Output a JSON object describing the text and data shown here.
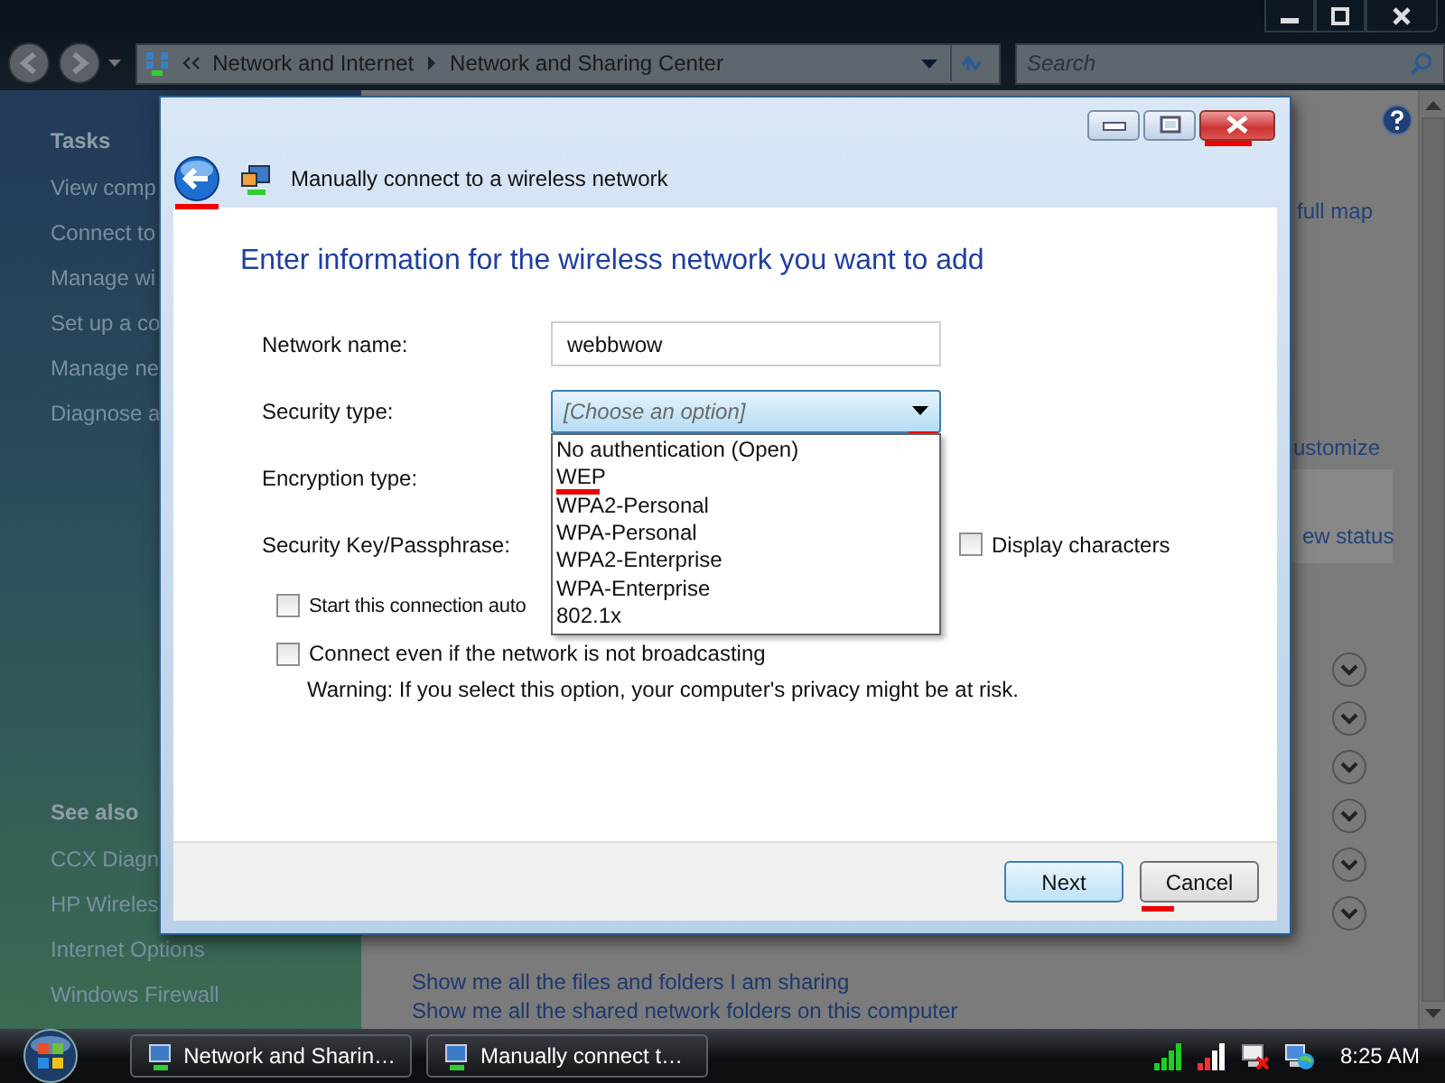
{
  "explorer": {
    "breadcrumb": [
      "Network and Internet",
      "Network and Sharing Center"
    ],
    "search": {
      "placeholder": "Search"
    },
    "tasks": {
      "heading": "Tasks",
      "items": [
        "View comp",
        "Connect to",
        "Manage wi",
        "Set up a co",
        "Manage ne",
        "Diagnose a"
      ]
    },
    "see_also": {
      "heading": "See also",
      "items": [
        "CCX Diagn",
        "HP Wireles",
        "Internet Options",
        "Windows Firewall"
      ]
    },
    "fragments": {
      "map_link": "full map",
      "customize_link": "ustomize",
      "status_link": "ew status"
    },
    "expand_buttons": [
      {
        "expanded": false
      },
      {
        "expanded": false
      },
      {
        "expanded": false
      },
      {
        "expanded": false
      },
      {
        "expanded": false
      },
      {
        "expanded": false
      }
    ],
    "links": [
      "Show me all the files and folders I am sharing",
      "Show me all the shared network folders on this computer"
    ]
  },
  "dialog": {
    "title": "Manually connect to a wireless network",
    "back_marked": true,
    "close_marked": true,
    "heading": "Enter information for the wireless network you want to add",
    "network_name": {
      "label": "Network name:",
      "value": "webbwow"
    },
    "security_type": {
      "label": "Security type:",
      "value": "[Choose an option]",
      "expanded": true,
      "arrow_marked": true,
      "options": [
        {
          "label": "No authentication (Open)",
          "marked": false
        },
        {
          "label": "WEP",
          "marked": true
        },
        {
          "label": "WPA2-Personal",
          "marked": false
        },
        {
          "label": "WPA-Personal",
          "marked": false
        },
        {
          "label": "WPA2-Enterprise",
          "marked": false
        },
        {
          "label": "WPA-Enterprise",
          "marked": false
        },
        {
          "label": "802.1x",
          "marked": false
        }
      ]
    },
    "encryption_type": {
      "label": "Encryption type:"
    },
    "security_key": {
      "label": "Security Key/Passphrase:"
    },
    "display_characters": {
      "label": "Display characters",
      "checked": false
    },
    "checkboxes": [
      {
        "label": "Start this connection auto",
        "checked": false
      },
      {
        "label": "Connect even if the network is not broadcasting",
        "checked": false
      }
    ],
    "warning": "Warning: If you select this option, your computer's privacy might be at risk.",
    "buttons": [
      {
        "label": "Next",
        "default": true,
        "marked": false
      },
      {
        "label": "Cancel",
        "default": false,
        "marked": true
      }
    ]
  },
  "taskbar": {
    "tasks": [
      "Network and Sharin…",
      "Manually connect t…"
    ],
    "clock": "8:25 AM"
  }
}
